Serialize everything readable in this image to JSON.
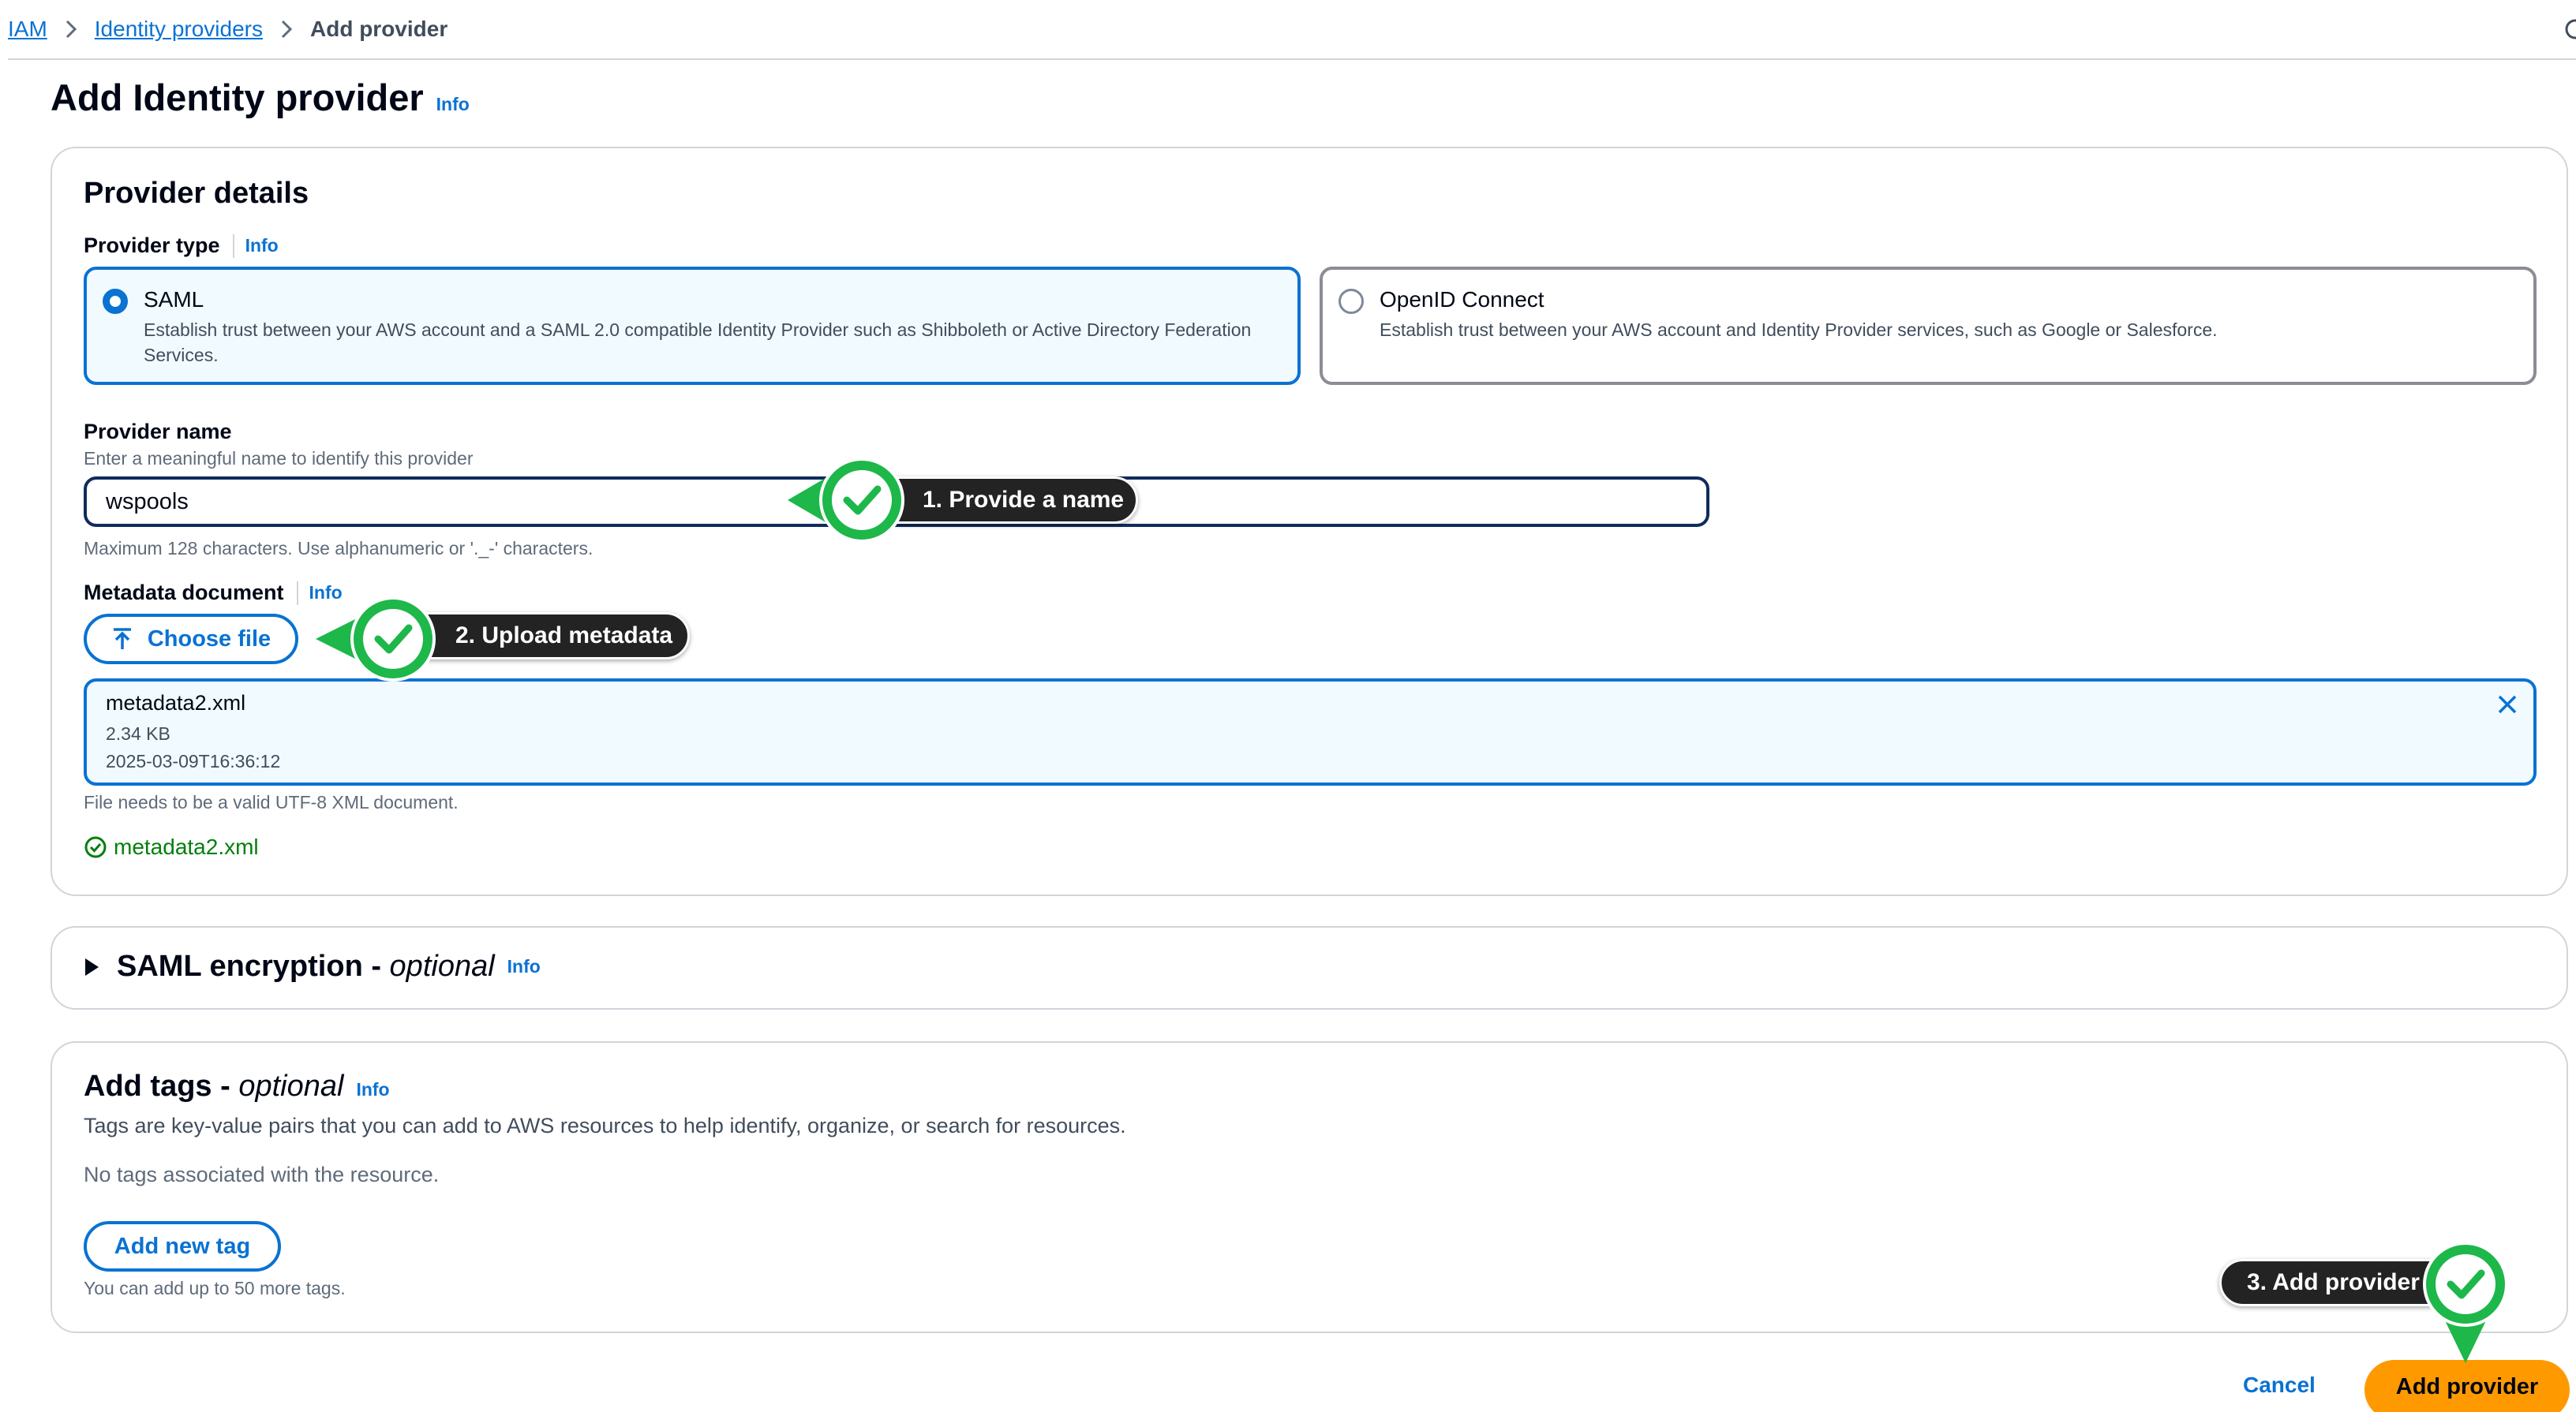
{
  "breadcrumb": {
    "items": [
      "IAM",
      "Identity providers",
      "Add provider"
    ]
  },
  "page": {
    "title": "Add Identity provider",
    "info_label": "Info"
  },
  "provider_details": {
    "title": "Provider details",
    "type_label": "Provider type",
    "info_label": "Info",
    "options": [
      {
        "name": "SAML",
        "description": "Establish trust between your AWS account and a SAML 2.0 compatible Identity Provider such as Shibboleth or Active Directory Federation Services.",
        "selected": true
      },
      {
        "name": "OpenID Connect",
        "description": "Establish trust between your AWS account and Identity Provider services, such as Google or Salesforce.",
        "selected": false
      }
    ],
    "name_label": "Provider name",
    "name_description": "Enter a meaningful name to identify this provider",
    "name_value": "wspools",
    "name_hint": "Maximum 128 characters. Use alphanumeric or '._-' characters.",
    "metadata_label": "Metadata document",
    "metadata_info": "Info",
    "choose_file_label": "Choose file",
    "file": {
      "name": "metadata2.xml",
      "size": "2.34 KB",
      "modified": "2025-03-09T16:36:12"
    },
    "file_hint": "File needs to be a valid UTF-8 XML document.",
    "file_status": "metadata2.xml"
  },
  "encryption": {
    "title": "SAML encryption - ",
    "title_suffix": "optional",
    "info_label": "Info"
  },
  "tags": {
    "title": "Add tags - ",
    "title_suffix": "optional",
    "info_label": "Info",
    "description": "Tags are key-value pairs that you can add to AWS resources to help identify, organize, or search for resources.",
    "empty_text": "No tags associated with the resource.",
    "add_button": "Add new tag",
    "hint": "You can add up to 50 more tags."
  },
  "footer": {
    "cancel_label": "Cancel",
    "submit_label": "Add provider"
  },
  "annotations": {
    "step1": "1. Provide a name",
    "step2": "2. Upload metadata",
    "step3": "3. Add provider"
  },
  "colors": {
    "link": "#0972d3",
    "primary_button": "#ff9900",
    "success": "#037f0c",
    "annotation_marker": "#1db74a",
    "annotation_pill": "#232323"
  },
  "icons": [
    "chevron-right-icon",
    "upload-icon",
    "close-icon",
    "check-circle-icon",
    "caret-right-icon",
    "check-marker-icon"
  ]
}
